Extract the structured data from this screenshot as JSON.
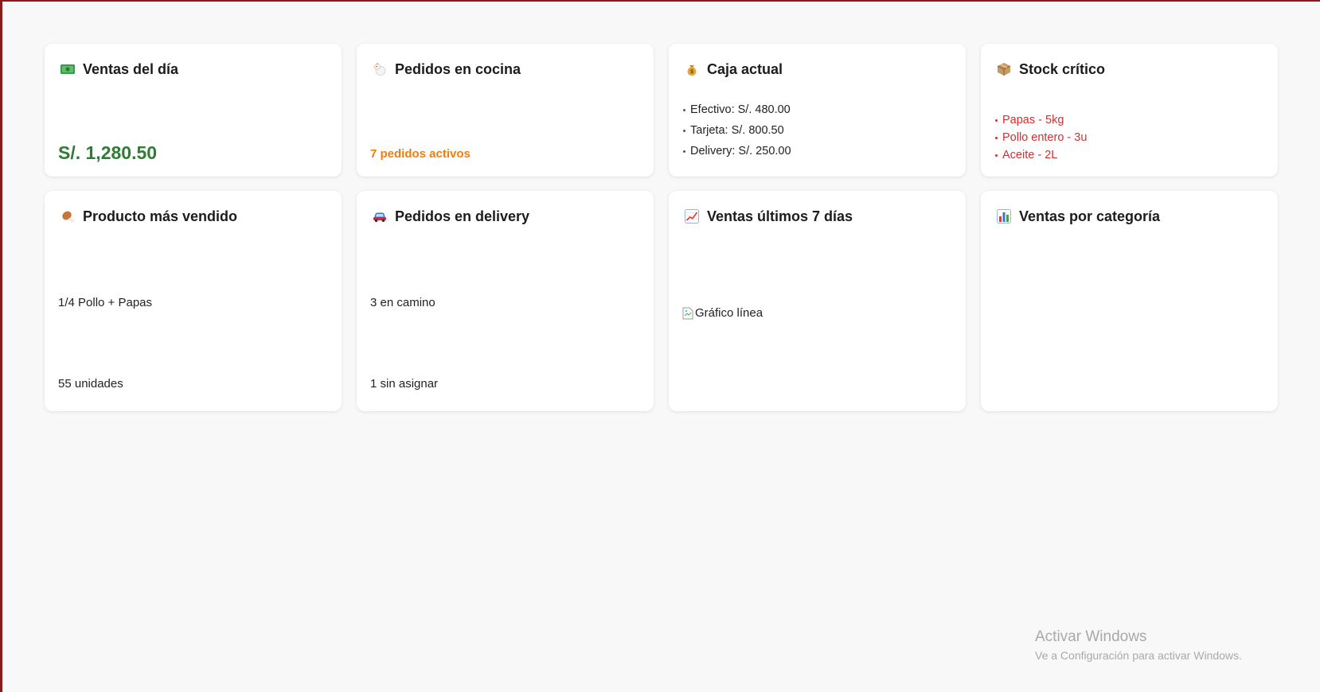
{
  "cards_row1": [
    {
      "title": "Ventas del día",
      "icon": "money-bill-icon",
      "value": "S/. 1,280.50"
    },
    {
      "title": "Pedidos en cocina",
      "icon": "chicken-icon",
      "status": "7 pedidos activos"
    },
    {
      "title": "Caja actual",
      "icon": "money-bag-icon",
      "items": [
        "Efectivo: S/. 480.00",
        "Tarjeta: S/. 800.50",
        "Delivery: S/. 250.00"
      ]
    },
    {
      "title": "Stock crítico",
      "icon": "package-icon",
      "items": [
        "Papas - 5kg",
        "Pollo entero - 3u",
        "Aceite - 2L"
      ]
    }
  ],
  "cards_row2": [
    {
      "title": "Producto más vendido",
      "icon": "poultry-leg-icon",
      "line1": "1/4 Pollo + Papas",
      "line2": "55 unidades"
    },
    {
      "title": "Pedidos en delivery",
      "icon": "car-icon",
      "line1": "3 en camino",
      "line2": "1 sin asignar"
    },
    {
      "title": "Ventas últimos 7 días",
      "icon": "chart-increasing-icon",
      "image_alt": "Gráfico línea"
    },
    {
      "title": "Ventas por categoría",
      "icon": "bar-chart-icon"
    }
  ],
  "watermark": {
    "line1": "Activar Windows",
    "line2": "Ve a Configuración para activar Windows."
  },
  "colors": {
    "money_green": "#2e7d32",
    "status_orange": "#f07d0c",
    "critical_red": "#d32f2f",
    "frame": "#8b1a1a"
  }
}
